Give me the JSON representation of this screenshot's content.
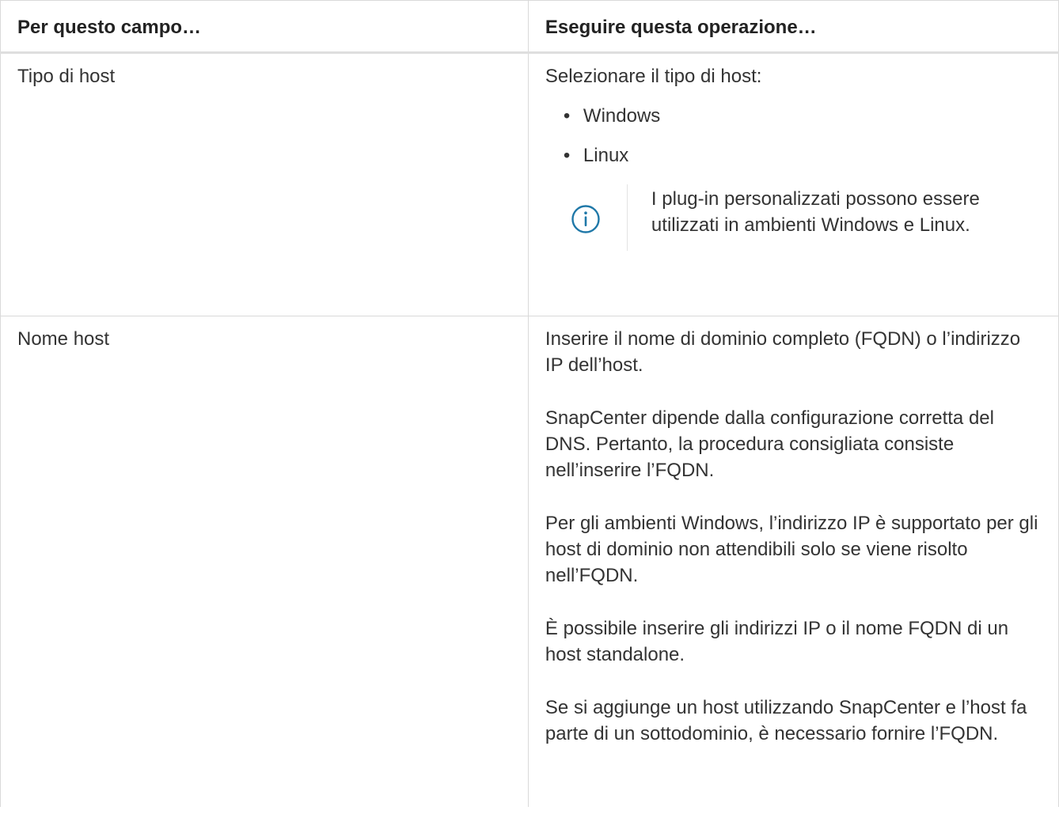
{
  "table": {
    "headers": {
      "field": "Per questo campo…",
      "action": "Eseguire questa operazione…"
    },
    "rows": [
      {
        "field": "Tipo di host",
        "intro": "Selezionare il tipo di host:",
        "options": [
          "Windows",
          "Linux"
        ],
        "note": {
          "icon": "info-circle-icon",
          "text": "I plug-in personalizzati possono essere utilizzati in ambienti Windows e Linux."
        }
      },
      {
        "field": "Nome host",
        "paragraphs": [
          "Inserire il nome di dominio completo (FQDN) o l’indirizzo IP dell’host.",
          "SnapCenter dipende dalla configurazione corretta del DNS. Pertanto, la procedura consigliata consiste nell’inserire l’FQDN.",
          "Per gli ambienti Windows, l’indirizzo IP è supportato per gli host di dominio non attendibili solo se viene risolto nell’FQDN.",
          "È possibile inserire gli indirizzi IP o il nome FQDN di un host standalone.",
          "Se si aggiunge un host utilizzando SnapCenter e l’host fa parte di un sottodominio, è necessario fornire l’FQDN."
        ]
      }
    ]
  },
  "colors": {
    "text": "#333333",
    "border": "#d9d9d9",
    "icon": "#1f78a8"
  }
}
